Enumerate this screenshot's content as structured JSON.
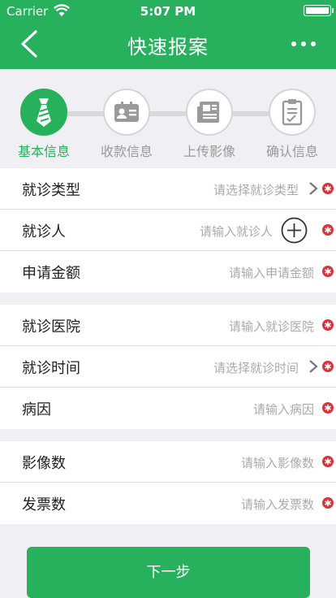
{
  "status_bar": {
    "carrier": "Carrier",
    "time": "5:07 PM"
  },
  "header": {
    "title": "快速报案"
  },
  "steps": [
    {
      "label": "基本信息",
      "icon": "tie-icon",
      "active": true
    },
    {
      "label": "收款信息",
      "icon": "id-card-icon",
      "active": false
    },
    {
      "label": "上传影像",
      "icon": "newspaper-icon",
      "active": false
    },
    {
      "label": "确认信息",
      "icon": "clipboard-icon",
      "active": false
    }
  ],
  "form": {
    "visit_type": {
      "label": "就诊类型",
      "placeholder": "请选择就诊类型"
    },
    "patient": {
      "label": "就诊人",
      "placeholder": "请输入就诊人"
    },
    "amount": {
      "label": "申请金额",
      "placeholder": "请输入申请金额"
    },
    "hospital": {
      "label": "就诊医院",
      "placeholder": "请输入就诊医院"
    },
    "visit_time": {
      "label": "就诊时间",
      "placeholder": "请选择就诊时间"
    },
    "cause": {
      "label": "病因",
      "placeholder": "请输入病因"
    },
    "image_count": {
      "label": "影像数",
      "placeholder": "请输入影像数"
    },
    "invoice_count": {
      "label": "发票数",
      "placeholder": "请输入发票数"
    }
  },
  "next_button": {
    "label": "下一步"
  },
  "colors": {
    "primary": "#27b15d",
    "required": "#d9343a",
    "inactive": "#9a9a9a"
  }
}
